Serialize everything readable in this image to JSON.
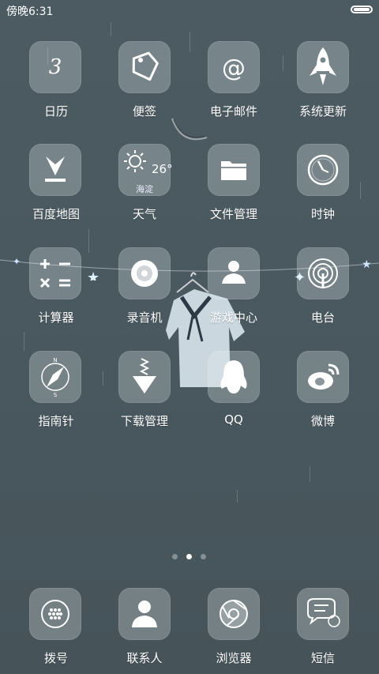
{
  "status_bar": {
    "time": "傍晚6:31"
  },
  "apps": [
    {
      "label": "日历",
      "icon": "calendar-icon",
      "detail": "3"
    },
    {
      "label": "便签",
      "icon": "tag-icon"
    },
    {
      "label": "电子邮件",
      "icon": "at-sign-icon"
    },
    {
      "label": "系统更新",
      "icon": "rocket-icon"
    },
    {
      "label": "百度地图",
      "icon": "map-pin-icon"
    },
    {
      "label": "天气",
      "icon": "sun-icon",
      "temperature": "26°",
      "city": "海淀"
    },
    {
      "label": "文件管理",
      "icon": "folder-icon"
    },
    {
      "label": "时钟",
      "icon": "clock-icon"
    },
    {
      "label": "计算器",
      "icon": "calculator-icon"
    },
    {
      "label": "录音机",
      "icon": "record-icon"
    },
    {
      "label": "游戏中心",
      "icon": "game-user-icon"
    },
    {
      "label": "电台",
      "icon": "radio-icon"
    },
    {
      "label": "指南针",
      "icon": "compass-icon"
    },
    {
      "label": "下载管理",
      "icon": "download-icon"
    },
    {
      "label": "QQ",
      "icon": "penguin-icon"
    },
    {
      "label": "微博",
      "icon": "weibo-icon"
    }
  ],
  "page_indicator": {
    "total": 3,
    "current": 2
  },
  "dock": [
    {
      "label": "拨号",
      "icon": "dialpad-icon"
    },
    {
      "label": "联系人",
      "icon": "contact-icon"
    },
    {
      "label": "浏览器",
      "icon": "browser-icon"
    },
    {
      "label": "短信",
      "icon": "message-icon"
    }
  ]
}
